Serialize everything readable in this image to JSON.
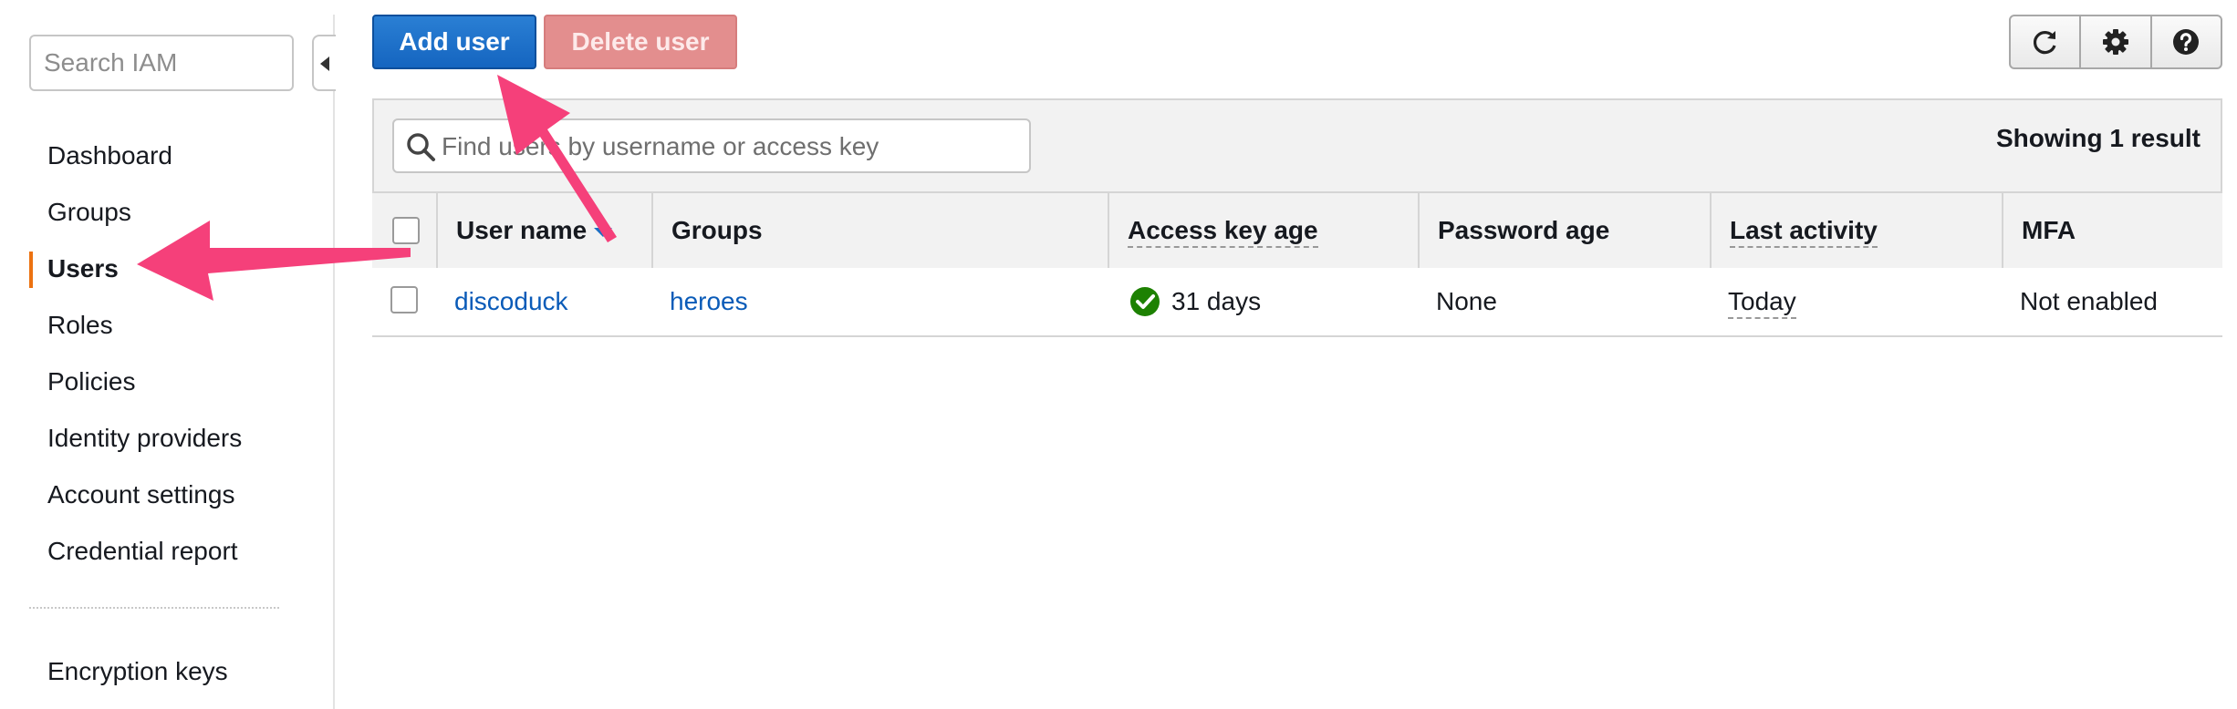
{
  "sidebar": {
    "search_placeholder": "Search IAM",
    "items": [
      {
        "label": "Dashboard",
        "active": false
      },
      {
        "label": "Groups",
        "active": false
      },
      {
        "label": "Users",
        "active": true
      },
      {
        "label": "Roles",
        "active": false
      },
      {
        "label": "Policies",
        "active": false
      },
      {
        "label": "Identity providers",
        "active": false
      },
      {
        "label": "Account settings",
        "active": false
      },
      {
        "label": "Credential report",
        "active": false
      }
    ],
    "extra_item": "Encryption keys",
    "active_accent": "#ec7211"
  },
  "toolbar": {
    "add_user_label": "Add user",
    "delete_user_label": "Delete user",
    "icons": [
      "refresh-icon",
      "gear-icon",
      "help-icon"
    ]
  },
  "table": {
    "filter_placeholder": "Find users by username or access key",
    "result_count_text": "Showing 1 result",
    "columns": [
      "User name",
      "Groups",
      "Access key age",
      "Password age",
      "Last activity",
      "MFA"
    ],
    "sorted_column": "User name",
    "rows": [
      {
        "user_name": "discoduck",
        "groups": "heroes",
        "access_key_age": "31 days",
        "access_key_status": "ok",
        "password_age": "None",
        "last_activity": "Today",
        "mfa": "Not enabled"
      }
    ]
  },
  "colors": {
    "primary_button": "#1565c0",
    "disabled_delete_button": "#e38e8e",
    "link": "#0a5bb8",
    "annotation_arrow": "#f5407a",
    "status_ok": "#1d8102"
  }
}
